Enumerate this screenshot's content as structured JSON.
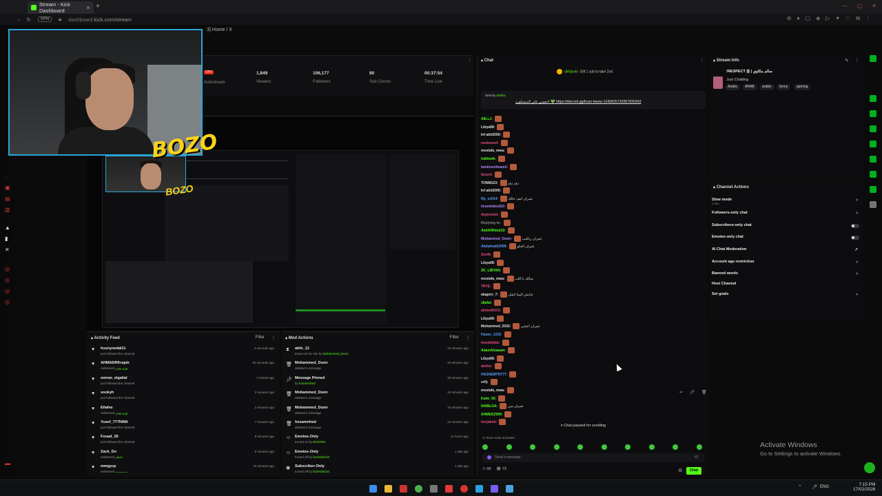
{
  "browser": {
    "tab_title": "Stream - Kick Dashboard",
    "new_tab": "+",
    "url_prefix": "dashboard.",
    "url": "kick.com/stream",
    "vpn": "VPN"
  },
  "breadcrumb": "3] Home / X",
  "overlay": {
    "brand": "BOZO",
    "brand_small": "BOZO"
  },
  "stats": {
    "live_badge": "OFF",
    "autostream": "Autostream",
    "items": [
      {
        "value": "1,849",
        "label": "Viewers"
      },
      {
        "value": "106,177",
        "label": "Followers"
      },
      {
        "value": "80",
        "label": "Sub Counts"
      },
      {
        "value": "00:37:54",
        "label": "Time Live"
      }
    ]
  },
  "activity_feed": {
    "title": "Activity Feed",
    "filter": "Filter",
    "rows": [
      {
        "name": "husnynedal11",
        "sub": "just followed the channel",
        "sub_green": "",
        "time": "3 seconds ago"
      },
      {
        "name": "AHMADRKrajah",
        "sub": "redeemed",
        "sub_green": "بوزو بوس",
        "time": "30 seconds ago"
      },
      {
        "name": "omran_elgallal",
        "sub": "just followed the channel",
        "sub_green": "",
        "time": "1 minute ago"
      },
      {
        "name": "sookyh",
        "sub": "just followed the channel",
        "sub_green": "",
        "time": "2 minutes ago"
      },
      {
        "name": "Ellafee",
        "sub": "redeemed",
        "sub_green": "بوزو بوس",
        "time": "3 minutes ago"
      },
      {
        "name": "Yusef_777NWA",
        "sub": "just followed the channel",
        "sub_green": "",
        "time": "7 minutes ago"
      },
      {
        "name": "Fouad_26",
        "sub": "just followed the channel",
        "sub_green": "",
        "time": "8 minutes ago"
      },
      {
        "name": "Zack_Do",
        "sub": "redeemed",
        "sub_green": "انتظر",
        "time": "9 minutes ago"
      },
      {
        "name": "mmgyuy",
        "sub": "redeemed",
        "sub_green": "ـــــــــــــ",
        "time": "10 minutes ago"
      }
    ]
  },
  "mod_actions": {
    "title": "Mod Actions",
    "filter": "Filter",
    "rows": [
      {
        "name": "abfo_12",
        "sub": "timed out for 10s by ",
        "sub_green": "Mohammed_Dunn",
        "time": "19 minutes ago"
      },
      {
        "name": "Mohammed_Dunn",
        "sub": "deleted a message",
        "sub_green": "",
        "time": "20 minutes ago"
      },
      {
        "name": "Message Pinned",
        "sub": "by ",
        "sub_green": "hosamnhed",
        "time": "30 minutes ago"
      },
      {
        "name": "Mohammed_Dunn",
        "sub": "deleted a message",
        "sub_green": "",
        "time": "32 minutes ago"
      },
      {
        "name": "Mohammed_Dunn",
        "sub": "deleted a message",
        "sub_green": "",
        "time": "33 minutes ago"
      },
      {
        "name": "hosamnhed",
        "sub": "deleted a message",
        "sub_green": "",
        "time": "34 minutes ago"
      },
      {
        "name": "Emotes-Only",
        "sub": "turned on by ",
        "sub_green": "BOZO96",
        "time": "14 hours ago"
      },
      {
        "name": "Emotes-Only",
        "sub": "turned off by ",
        "sub_green": "lamlAbdo10",
        "time": "1 day ago"
      },
      {
        "name": "Subscriber-Only",
        "sub": "turned off by ",
        "sub_green": "lamlAbdo10",
        "time": "1 day ago"
      }
    ]
  },
  "chat": {
    "title": "Chat",
    "gift_user": "rjkfnjooki",
    "gift_text": "Gift 1 sub to take 2nd",
    "pinned_by": "Sent by",
    "pinned_user": "BotRix",
    "pinned_text": "تابعوني على الديسكورد 💚",
    "pinned_link": "https://discord.gg/bozo-bwzw-1245825739367830343",
    "lines": [
      {
        "user": "A8LLJ:",
        "color": "#53fc18",
        "text": ""
      },
      {
        "user": "Libya98:",
        "color": "#e0e0e0",
        "text": ""
      },
      {
        "user": "Inf abh2000:",
        "color": "#e0e0e0",
        "text": ""
      },
      {
        "user": "noobsmuf:",
        "color": "#e84c7d",
        "text": ""
      },
      {
        "user": "mostafa_mwa:",
        "color": "#e0e0e0",
        "text": ""
      },
      {
        "user": "hdkfwdk:",
        "color": "#53fc18",
        "text": ""
      },
      {
        "user": "tamimesliteam2:",
        "color": "#b388ff",
        "text": ""
      },
      {
        "user": "fazord:",
        "color": "#e84c7d",
        "text": ""
      },
      {
        "user": "TONM123:",
        "color": "#e0e0e0",
        "text": "زوز زوز"
      },
      {
        "user": "Inf abh2000:",
        "color": "#e0e0e0",
        "text": ""
      },
      {
        "user": "Rp_xx014:",
        "color": "#5b9cff",
        "text": "عمران كيف حالك"
      },
      {
        "user": "imsolobkod10:",
        "color": "#b388ff",
        "text": ""
      },
      {
        "user": "dopenoob:",
        "color": "#e84c7d",
        "text": ""
      },
      {
        "user": "Replying to: ",
        "color": "#888888",
        "text": ""
      },
      {
        "user": "AbdAlWdod10:",
        "color": "#53fc18",
        "text": ""
      },
      {
        "user": "Mohammed_Dunn:",
        "color": "#b388ff",
        "text": "عمران رياقيب"
      },
      {
        "user": "Abdalmalk2009:",
        "color": "#5b9cff",
        "text": "عمران الحلو"
      },
      {
        "user": "Sosfk:",
        "color": "#e84c7d",
        "text": ""
      },
      {
        "user": "Libya98:",
        "color": "#e0e0e0",
        "text": ""
      },
      {
        "user": "ZK_LIBYAN:",
        "color": "#53fc18",
        "text": ""
      },
      {
        "user": "mostafa_mwa:",
        "color": "#e0e0e0",
        "text": "ميالك يا اللب"
      },
      {
        "user": "7RYE:",
        "color": "#e84c7d",
        "text": ""
      },
      {
        "user": "alagore_7:",
        "color": "#e0e0e0",
        "text": "عتايش اليبيا انشل"
      },
      {
        "user": "18afat:",
        "color": "#53fc18",
        "text": ""
      },
      {
        "user": "ahmedh101:",
        "color": "#e84c7d",
        "text": ""
      },
      {
        "user": "Libya98:",
        "color": "#e0e0e0",
        "text": ""
      },
      {
        "user": "Mohammed_2032:",
        "color": "#e0e0e0",
        "text": "عمران اعشى"
      },
      {
        "user": "Hasan_1232:",
        "color": "#5b9cff",
        "text": ""
      },
      {
        "user": "hmnbbbbb:",
        "color": "#e84c7d",
        "text": ""
      },
      {
        "user": "AdamAlzaaam:",
        "color": "#53fc18",
        "text": ""
      },
      {
        "user": "Libya98:",
        "color": "#e0e0e0",
        "text": ""
      },
      {
        "user": "dorkle:",
        "color": "#e84c7d",
        "text": ""
      },
      {
        "user": "HASHEMTR777:",
        "color": "#5b9cff",
        "text": ""
      },
      {
        "user": "srlij:",
        "color": "#e0e0e0",
        "text": ""
      },
      {
        "user": "mostafa_mwa:",
        "color": "#e0e0e0",
        "text": ""
      },
      {
        "user": "Kalm_55:",
        "color": "#53fc18",
        "text": ""
      },
      {
        "user": "NABILOA:",
        "color": "#53fc18",
        "text": "عمران مين"
      },
      {
        "user": "AHMEDZ999:",
        "color": "#53fc18",
        "text": ""
      },
      {
        "user": "lorrjabub:",
        "color": "#e84c7d",
        "text": ""
      }
    ],
    "paused": "Chat paused for scrolling",
    "slow_mode": "Slow mode activated",
    "input_placeholder": "Send a message",
    "viewer_count": "00",
    "gift_count": "73",
    "send": "Chat"
  },
  "stream_info": {
    "title": "Stream Info",
    "stream_title": "!RESPECT 🇷 | سالم بنكاوي",
    "category": "Just Chatting",
    "tags": [
      "Arabic",
      "ARAB",
      "arabic",
      "funny",
      "gaming"
    ]
  },
  "channel_actions": {
    "title": "Channel Actions",
    "rows": [
      {
        "label": "Slow mode",
        "sub": "1 sec",
        "type": "chevron"
      },
      {
        "label": "Followers-only chat",
        "sub": "",
        "type": "chevron"
      },
      {
        "label": "Subscribers-only chat",
        "sub": "",
        "type": "toggle"
      },
      {
        "label": "Emotes-only chat",
        "sub": "",
        "type": "toggle"
      },
      {
        "label": "AI Chat Moderation",
        "sub": "",
        "type": "link"
      },
      {
        "label": "Account age restriction",
        "sub": "",
        "type": "chevron"
      },
      {
        "label": "Banned words",
        "sub": "",
        "type": "chevron"
      },
      {
        "label": "Host Channel",
        "sub": "",
        "type": "none"
      },
      {
        "label": "Set goals",
        "sub": "",
        "type": "chevron"
      }
    ]
  },
  "activate_windows": {
    "line1": "Activate Windows",
    "line2": "Go to Settings to activate Windows."
  },
  "taskbar": {
    "lang": "ENG",
    "time": "7:15 PM",
    "date": "17/02/2026"
  }
}
